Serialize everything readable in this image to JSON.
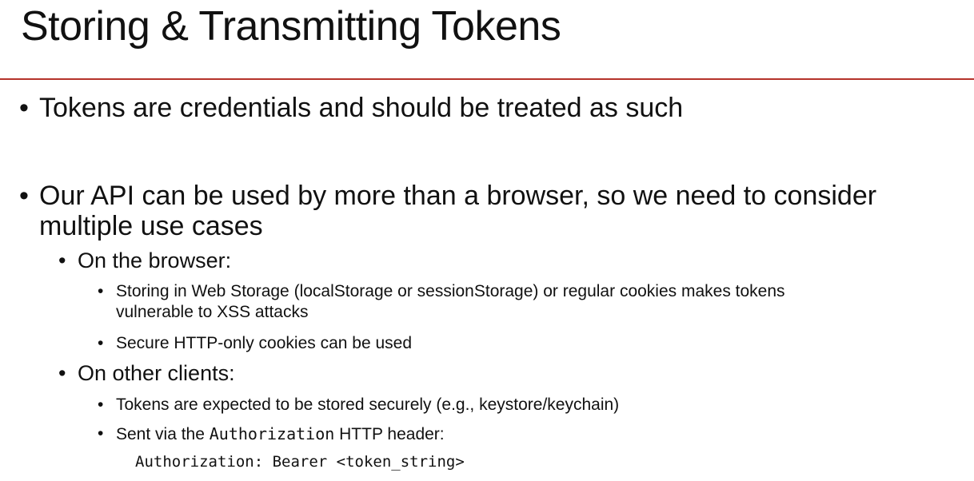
{
  "slide": {
    "title": "Storing & Transmitting Tokens",
    "bullet_glyph": "•",
    "points": {
      "p1": "Tokens are credentials and should be treated as such",
      "p2_line1": "Our API can be used by more than a browser, so we need to consider",
      "p2_line2": "multiple use cases",
      "browser_heading": "On the browser:",
      "browser_b1_line1": "Storing in Web Storage (localStorage or sessionStorage) or regular cookies makes tokens",
      "browser_b1_line2": "vulnerable to XSS attacks",
      "browser_b2": "Secure HTTP-only cookies can be used",
      "other_heading": "On other clients:",
      "other_b1": "Tokens are expected to be stored securely (e.g., keystore/keychain)",
      "other_b2_prefix": "Sent via the ",
      "other_b2_code": "Authorization",
      "other_b2_suffix": " HTTP header:",
      "code_example": "Authorization: Bearer <token_string>"
    },
    "accent_color": "#b5332a"
  }
}
